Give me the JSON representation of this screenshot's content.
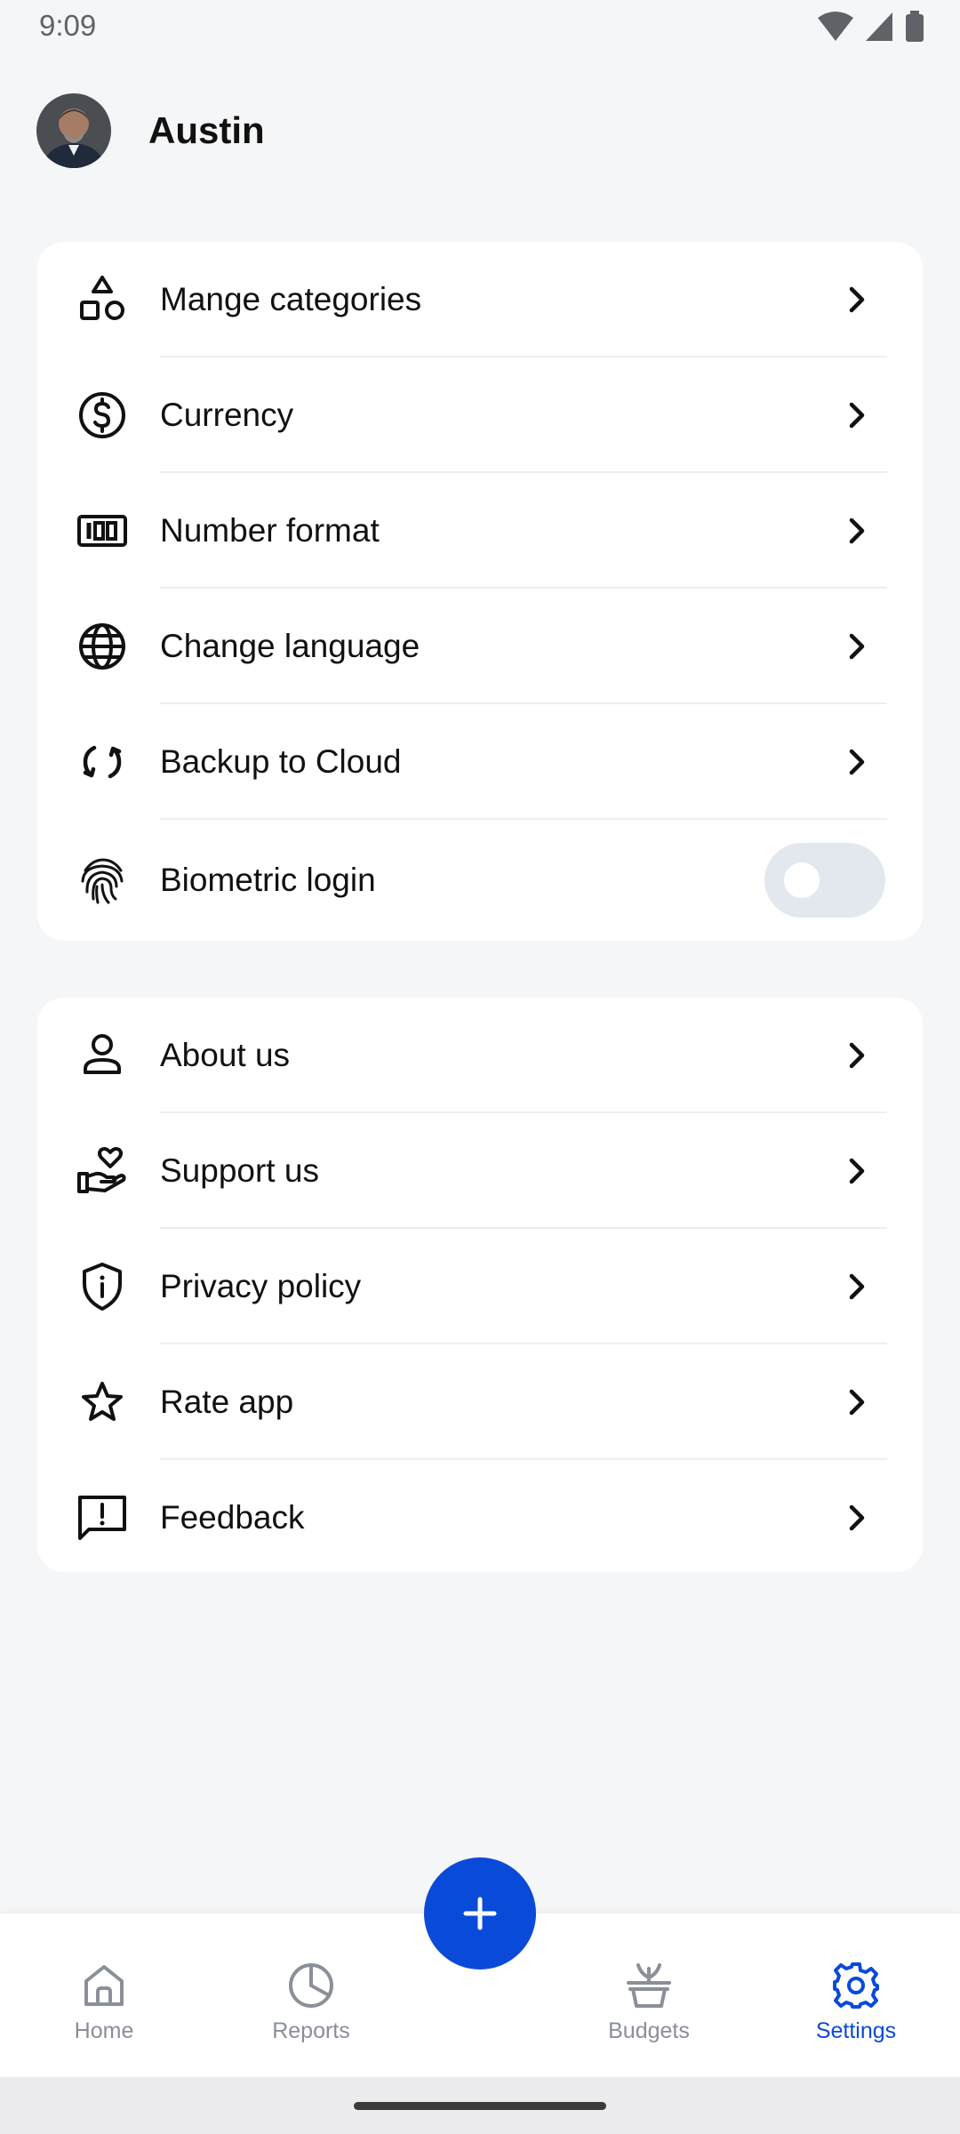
{
  "status_bar": {
    "time": "9:09"
  },
  "profile": {
    "name": "Austin"
  },
  "settings_group_1": [
    {
      "label": "Mange categories",
      "icon": "shapes-icon"
    },
    {
      "label": "Currency",
      "icon": "dollar-circle-icon"
    },
    {
      "label": "Number format",
      "icon": "number-format-icon"
    },
    {
      "label": "Change language",
      "icon": "globe-icon"
    },
    {
      "label": "Backup to Cloud",
      "icon": "sync-icon"
    },
    {
      "label": "Biometric login",
      "icon": "fingerprint-icon",
      "toggle": false
    }
  ],
  "settings_group_2": [
    {
      "label": "About us",
      "icon": "person-icon"
    },
    {
      "label": "Support us",
      "icon": "hand-heart-icon"
    },
    {
      "label": "Privacy policy",
      "icon": "shield-info-icon"
    },
    {
      "label": "Rate app",
      "icon": "star-icon"
    },
    {
      "label": "Feedback",
      "icon": "feedback-icon"
    }
  ],
  "bottom_nav": {
    "items": [
      {
        "label": "Home",
        "icon": "home-icon",
        "active": false
      },
      {
        "label": "Reports",
        "icon": "pie-chart-icon",
        "active": false
      },
      {
        "label": "Budgets",
        "icon": "plant-pot-icon",
        "active": false
      },
      {
        "label": "Settings",
        "icon": "gear-icon",
        "active": true
      }
    ],
    "fab_icon": "plus-icon"
  },
  "colors": {
    "accent": "#0a4ad8",
    "background": "#f5f6f8",
    "inactive": "#8a8f98",
    "toggle_track": "#e3e8ef"
  }
}
